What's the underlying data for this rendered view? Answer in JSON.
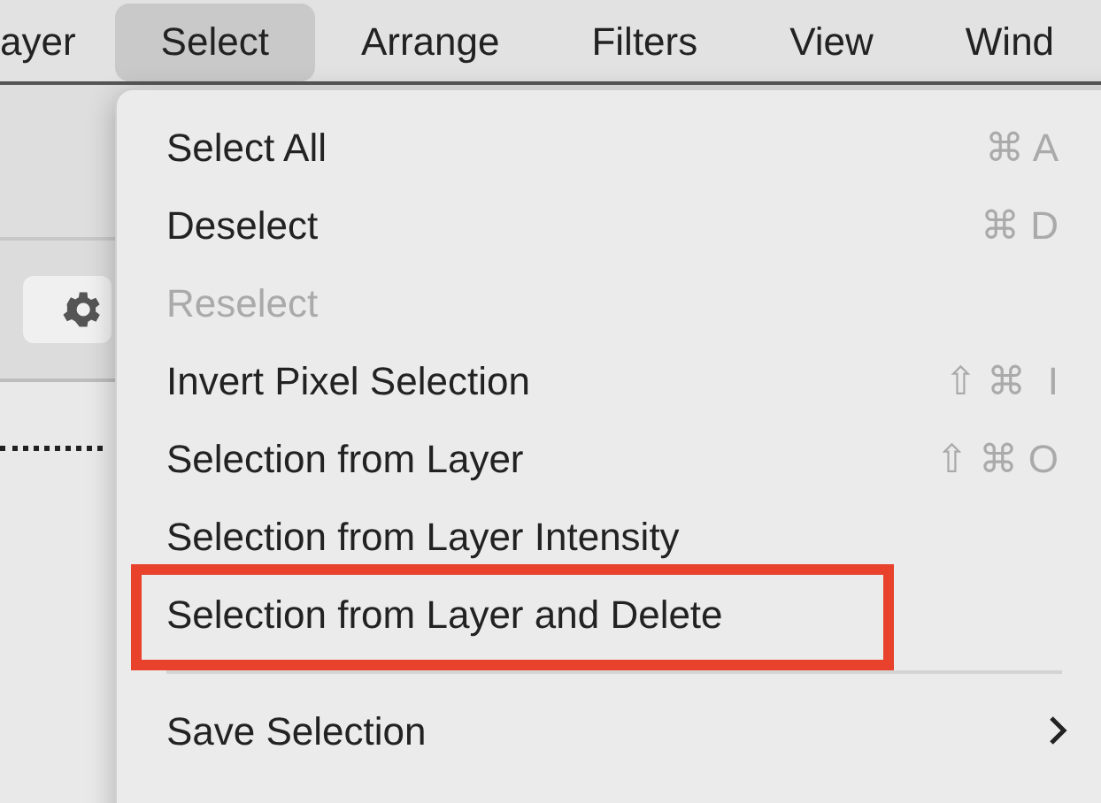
{
  "menubar": [
    {
      "label": "ayer",
      "selected": false
    },
    {
      "label": "Select",
      "selected": true
    },
    {
      "label": "Arrange",
      "selected": false
    },
    {
      "label": "Filters",
      "selected": false
    },
    {
      "label": "View",
      "selected": false
    },
    {
      "label": "Wind",
      "selected": false
    }
  ],
  "menu": {
    "items": [
      {
        "kind": "item",
        "label": "Select All",
        "shortcut": "⌘ A",
        "disabled": false,
        "annotated": false
      },
      {
        "kind": "item",
        "label": "Deselect",
        "shortcut": "⌘ D",
        "disabled": false,
        "annotated": false
      },
      {
        "kind": "item",
        "label": "Reselect",
        "disabled": true,
        "annotated": false
      },
      {
        "kind": "item",
        "label": "Invert Pixel Selection",
        "shortcut": "⇧ ⌘  I",
        "disabled": false,
        "annotated": false
      },
      {
        "kind": "item",
        "label": "Selection from Layer",
        "shortcut": "⇧ ⌘ O",
        "disabled": false,
        "annotated": false
      },
      {
        "kind": "item",
        "label": "Selection from Layer Intensity",
        "disabled": false,
        "annotated": false
      },
      {
        "kind": "item",
        "label": "Selection from Layer and Delete",
        "disabled": false,
        "annotated": true
      },
      {
        "kind": "separator"
      },
      {
        "kind": "submenu",
        "label": "Save Selection",
        "disabled": false,
        "annotated": false
      }
    ]
  }
}
